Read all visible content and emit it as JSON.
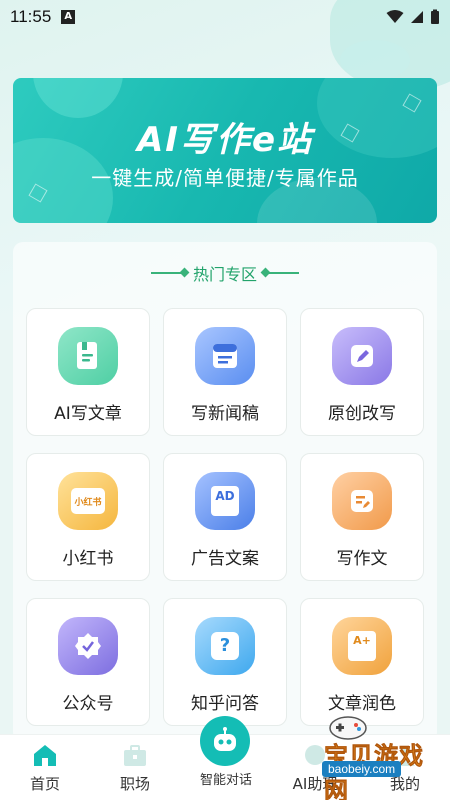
{
  "status_bar": {
    "time": "11:55",
    "a_badge": "A"
  },
  "banner": {
    "title": "AI写作e站",
    "subtitle": "一键生成/简单便捷/专属作品"
  },
  "section": {
    "title": "热门专区"
  },
  "cards": [
    {
      "label": "AI写文章",
      "icon": "document-icon",
      "color": "#4fcfa4"
    },
    {
      "label": "写新闻稿",
      "icon": "news-icon",
      "color": "#5a8ef0"
    },
    {
      "label": "原创改写",
      "icon": "pen-icon",
      "color": "#8a78e6"
    },
    {
      "label": "小红书",
      "icon": "xiaohongshu-icon",
      "color": "#f5b63e",
      "icon_text": "小红书"
    },
    {
      "label": "广告文案",
      "icon": "ad-icon",
      "color": "#4b7fe8",
      "icon_text": "AD"
    },
    {
      "label": "写作文",
      "icon": "essay-icon",
      "color": "#f19a4a"
    },
    {
      "label": "公众号",
      "icon": "badge-icon",
      "color": "#7d6ee0"
    },
    {
      "label": "知乎问答",
      "icon": "question-icon",
      "color": "#3ea8ee",
      "icon_text": "?"
    },
    {
      "label": "文章润色",
      "icon": "polish-icon",
      "color": "#f0a23c",
      "icon_text": "A+"
    }
  ],
  "tabbar": {
    "items": [
      {
        "label": "首页",
        "icon": "home-icon",
        "active": true
      },
      {
        "label": "职场",
        "icon": "briefcase-icon",
        "active": false
      },
      {
        "label": "智能对话",
        "icon": "robot-icon",
        "active": false
      },
      {
        "label": "AI助理",
        "icon": "assistant-icon",
        "active": false
      },
      {
        "label": "我的",
        "icon": "profile-icon",
        "active": false
      }
    ]
  },
  "watermark": {
    "text": "宝贝游戏网",
    "url": "baobeiy.com"
  },
  "colors": {
    "accent": "#14bdb5",
    "section_green": "#22a36b"
  }
}
